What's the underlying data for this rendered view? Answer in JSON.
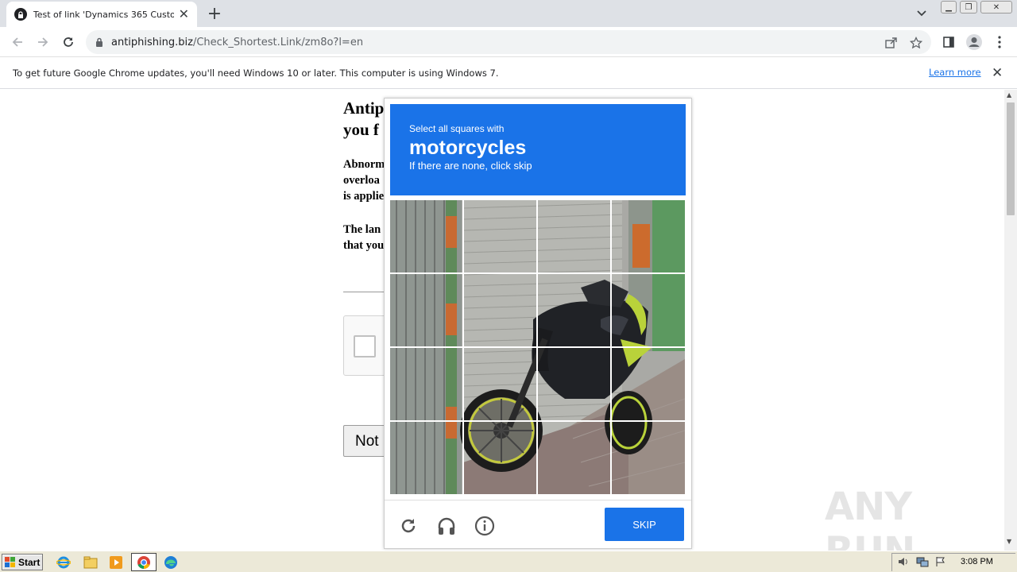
{
  "browser": {
    "tab_title": "Test of link 'Dynamics 365 Customer",
    "url_domain": "antiphishing.biz",
    "url_path": "/Check_Shortest.Link/zm8o?l=en"
  },
  "infobar": {
    "message": "To get future Google Chrome updates, you'll need Windows 10 or later. This computer is using Windows 7.",
    "link": "Learn more"
  },
  "page": {
    "heading_line1": "Antip",
    "heading_line2": "you f",
    "para1": [
      "Abnorm",
      "overloa",
      "is applie"
    ],
    "para2": [
      "The lan",
      "that you"
    ],
    "button": "Not"
  },
  "captcha": {
    "instruction": "Select all squares with",
    "object": "motorcycles",
    "hint": "If there are none, click skip",
    "skip_label": "SKIP",
    "grid_rows": 4,
    "grid_cols": 4,
    "colors": {
      "header": "#1a73e8"
    }
  },
  "watermark": "ANY RUN",
  "taskbar": {
    "start_label": "Start",
    "clock": "3:08 PM"
  }
}
